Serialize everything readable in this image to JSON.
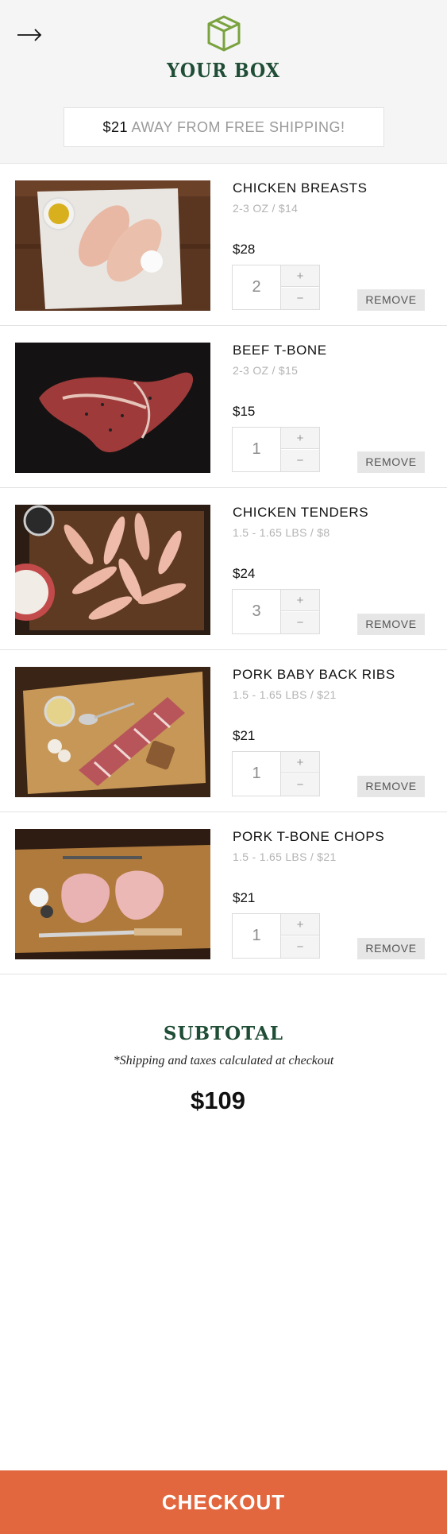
{
  "header": {
    "title": "YOUR BOX",
    "shipping_amount": "$21",
    "shipping_text": "AWAY FROM FREE SHIPPING!",
    "back_icon": "arrow-right-icon",
    "logo_icon": "box-icon",
    "accent_color": "#7aa23f",
    "title_color": "#1f4d35"
  },
  "items": [
    {
      "name": "CHICKEN BREASTS",
      "meta": "2-3 OZ / $14",
      "price": "$28",
      "qty": "2",
      "plus": "+",
      "minus": "−",
      "remove": "REMOVE"
    },
    {
      "name": "BEEF T-BONE",
      "meta": "2-3 OZ / $15",
      "price": "$15",
      "qty": "1",
      "plus": "+",
      "minus": "−",
      "remove": "REMOVE"
    },
    {
      "name": "CHICKEN TENDERS",
      "meta": "1.5 - 1.65 LBS / $8",
      "price": "$24",
      "qty": "3",
      "plus": "+",
      "minus": "−",
      "remove": "REMOVE"
    },
    {
      "name": "PORK BABY BACK RIBS",
      "meta": "1.5 - 1.65 LBS / $21",
      "price": "$21",
      "qty": "1",
      "plus": "+",
      "minus": "−",
      "remove": "REMOVE"
    },
    {
      "name": "PORK T-BONE CHOPS",
      "meta": "1.5 - 1.65 LBS / $21",
      "price": "$21",
      "qty": "1",
      "plus": "+",
      "minus": "−",
      "remove": "REMOVE"
    }
  ],
  "summary": {
    "title": "SUBTOTAL",
    "note": "*Shipping and taxes calculated at checkout",
    "amount": "$109"
  },
  "checkout": {
    "label": "CHECKOUT",
    "color": "#e2673f"
  }
}
